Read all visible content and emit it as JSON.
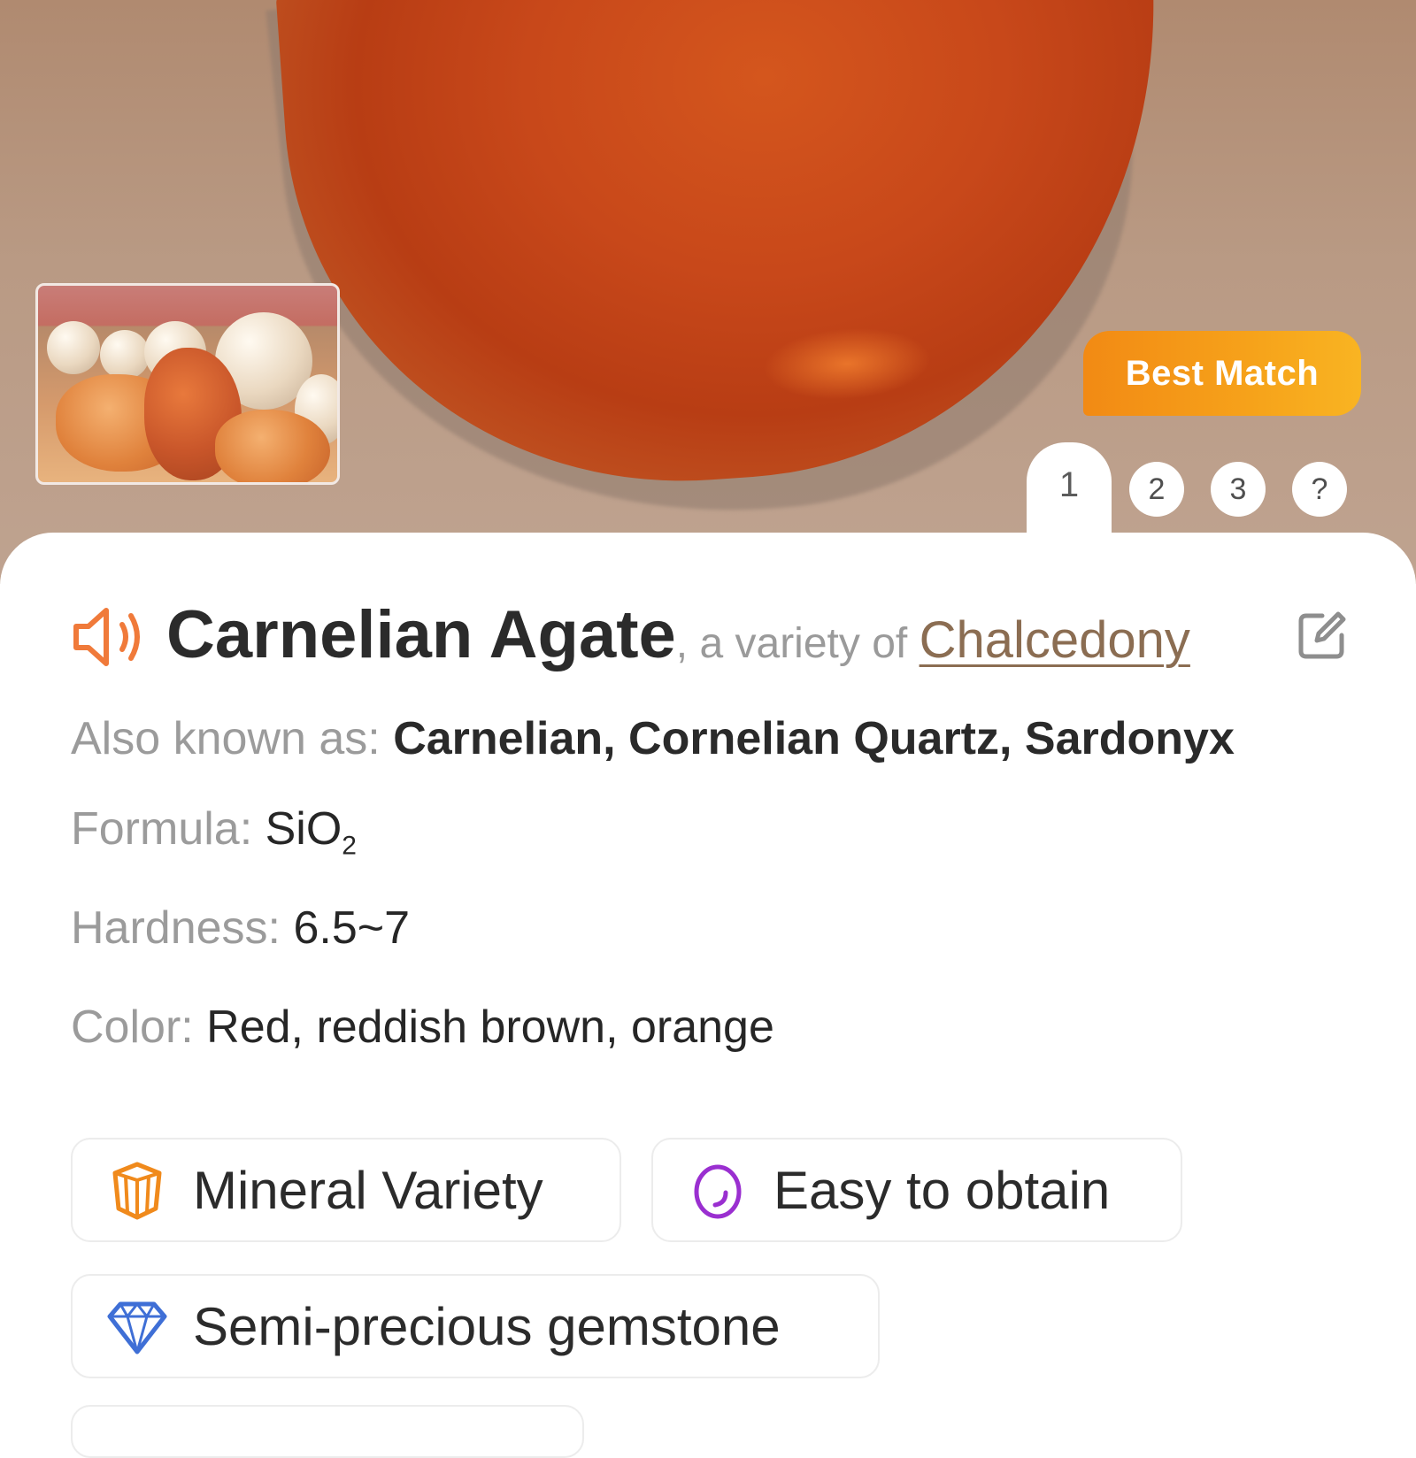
{
  "hero": {
    "badge_label": "Best Match",
    "pager": {
      "active": "1",
      "items": [
        "2",
        "3",
        "?"
      ]
    }
  },
  "result": {
    "name": "Carnelian Agate",
    "variety_prefix": ", a variety of ",
    "variety_link": "Chalcedony",
    "fields": {
      "also_known_as": {
        "label": "Also known as: ",
        "value": "Carnelian, Cornelian Quartz, Sardonyx"
      },
      "formula": {
        "label": "Formula: ",
        "value": "SiO",
        "subscript": "2"
      },
      "hardness": {
        "label": "Hardness: ",
        "value": "6.5~7"
      },
      "color": {
        "label": "Color: ",
        "value": "Red, reddish brown, orange"
      }
    },
    "tags": [
      {
        "label": "Mineral Variety",
        "icon": "crystal-icon",
        "color": "#f08a1c"
      },
      {
        "label": "Easy to obtain",
        "icon": "egg-icon",
        "color": "#9a2fd0"
      },
      {
        "label": "Semi-precious gemstone",
        "icon": "diamond-icon",
        "color": "#3f6fd6"
      }
    ]
  },
  "colors": {
    "accent_orange": "#f28a14",
    "link_brown": "#8b6d52",
    "speaker_orange": "#f07a3a"
  }
}
